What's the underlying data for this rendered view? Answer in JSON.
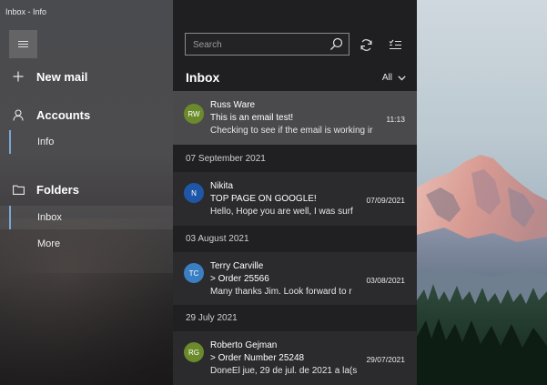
{
  "window": {
    "title": "Inbox - Info"
  },
  "sidebar": {
    "menu_icon": "hamburger-icon",
    "new_mail": {
      "label": "New mail",
      "icon": "plus-icon"
    },
    "accounts": {
      "label": "Accounts",
      "icon": "person-icon",
      "items": [
        {
          "label": "Info"
        }
      ]
    },
    "folders": {
      "label": "Folders",
      "icon": "folder-icon",
      "items": [
        {
          "label": "Inbox",
          "selected": true
        },
        {
          "label": "More"
        }
      ]
    }
  },
  "search": {
    "placeholder": "Search",
    "icon": "search-icon"
  },
  "toolbar": {
    "sync_icon": "sync-icon",
    "select_icon": "select-mode-icon"
  },
  "list": {
    "title": "Inbox",
    "filter_label": "All",
    "filter_icon": "chevron-down-icon",
    "messages": [
      {
        "initials": "RW",
        "avatar_color": "#6b8a2b",
        "sender": "Russ Ware",
        "subject": "This is an email test!",
        "date": "11:13",
        "preview": "Checking to see if the email is working ir",
        "selected": true
      }
    ],
    "groups": [
      {
        "label": "07 September 2021",
        "messages": [
          {
            "initials": "N",
            "avatar_color": "#1f57a8",
            "sender": "Nikita",
            "subject": "TOP PAGE ON GOOGLE!",
            "date": "07/09/2021",
            "preview": "Hello, Hope you are well, I was surf"
          }
        ]
      },
      {
        "label": "03 August 2021",
        "messages": [
          {
            "initials": "TC",
            "avatar_color": "#3b7fc3",
            "sender": "Terry Carville",
            "subject": "> Order 25566",
            "date": "03/08/2021",
            "preview": "Many thanks Jim. Look forward to r"
          }
        ]
      },
      {
        "label": "29 July 2021",
        "messages": [
          {
            "initials": "RG",
            "avatar_color": "#6b8a2b",
            "sender": "Roberto Gejman",
            "subject": "> Order Number 25248",
            "date": "29/07/2021",
            "preview": "DoneEl jue, 29 de jul. de 2021 a la(s"
          }
        ]
      }
    ]
  },
  "colors": {
    "accent": "#7aa6d8",
    "selected_row": "#4a4a4d",
    "list_bg": "#1f1f21"
  }
}
